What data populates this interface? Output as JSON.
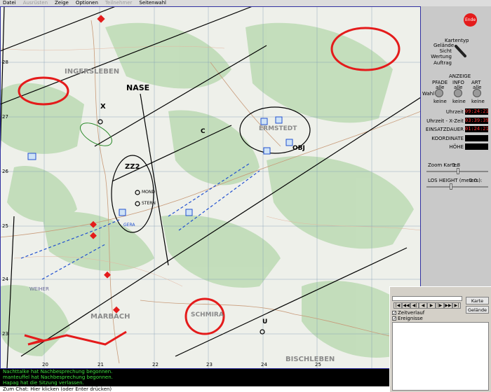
{
  "menu": [
    "Datei",
    "Ausrüsten",
    "Zeige",
    "Optionen",
    "Teilnehmer",
    "Seitenwahl"
  ],
  "menu_disabled": [
    false,
    true,
    false,
    false,
    true,
    false
  ],
  "ende_label": "Ende",
  "map_type": {
    "title": "Kartentyp",
    "options": [
      "Gelände",
      "Sicht",
      "Wertung",
      "Auftrag"
    ]
  },
  "anzeige": {
    "title": "ANZEIGE",
    "columns": [
      "PFADE",
      "INFO",
      "ART"
    ],
    "alle": "alle",
    "keine": "keine",
    "wahl": "Wahl"
  },
  "times": {
    "uhrzeit_label": "Uhrzeit",
    "uhrzeit": "09:24:21",
    "xzeit_label": "Uhrzeit - X-Zeit",
    "xzeit": "03:39:39",
    "einsatz_label": "EINSATZDAUER",
    "einsatz": "01:24:21",
    "koord_label": "KOORDINATE",
    "koord": "",
    "hoehe_label": "HÖHE",
    "hoehe": ""
  },
  "zoom": {
    "label": "Zoom Karte:",
    "value": "1.8"
  },
  "los": {
    "label": "LOS HEIGHT (meters):",
    "value": "2.0"
  },
  "chat": {
    "lines": [
      "Nachttalke hat Nachbesprechung begonnen.",
      "manteuffel hat Nachbesprechung begonnen.",
      "Hapag hat die Sitzung verlassen."
    ],
    "input_placeholder": "Zum Chat: Hier klicken (oder Enter drücken)"
  },
  "replay": {
    "karte": "Karte",
    "gelaende": "Gelände",
    "controls": [
      "|◀",
      "◀◀",
      "◀|",
      "◀",
      "▶",
      "|▶",
      "▶▶",
      "▶|"
    ],
    "zeitverlauf": "Zeitverlauf",
    "ereignisse": "Ereignisse"
  },
  "map": {
    "places": [
      "INGERSLEBEN",
      "MARBACH",
      "SCHMIRA",
      "ERMSTEDT",
      "BISCHLEBEN"
    ],
    "labels": [
      "NASE",
      "ZZ2",
      "X",
      "C",
      "U",
      "OBJ",
      "WEIHER",
      "MOND",
      "STERN",
      "GERA"
    ],
    "grid_x": [
      "20",
      "21",
      "22",
      "23",
      "24",
      "25"
    ],
    "grid_y": [
      "28",
      "27",
      "26",
      "25",
      "24",
      "23"
    ]
  },
  "colors": {
    "enemy_red": "#e41b1b",
    "friendly_blue": "#2050d0",
    "chat_green": "#3fe03f",
    "time_red": "#ff3030"
  }
}
